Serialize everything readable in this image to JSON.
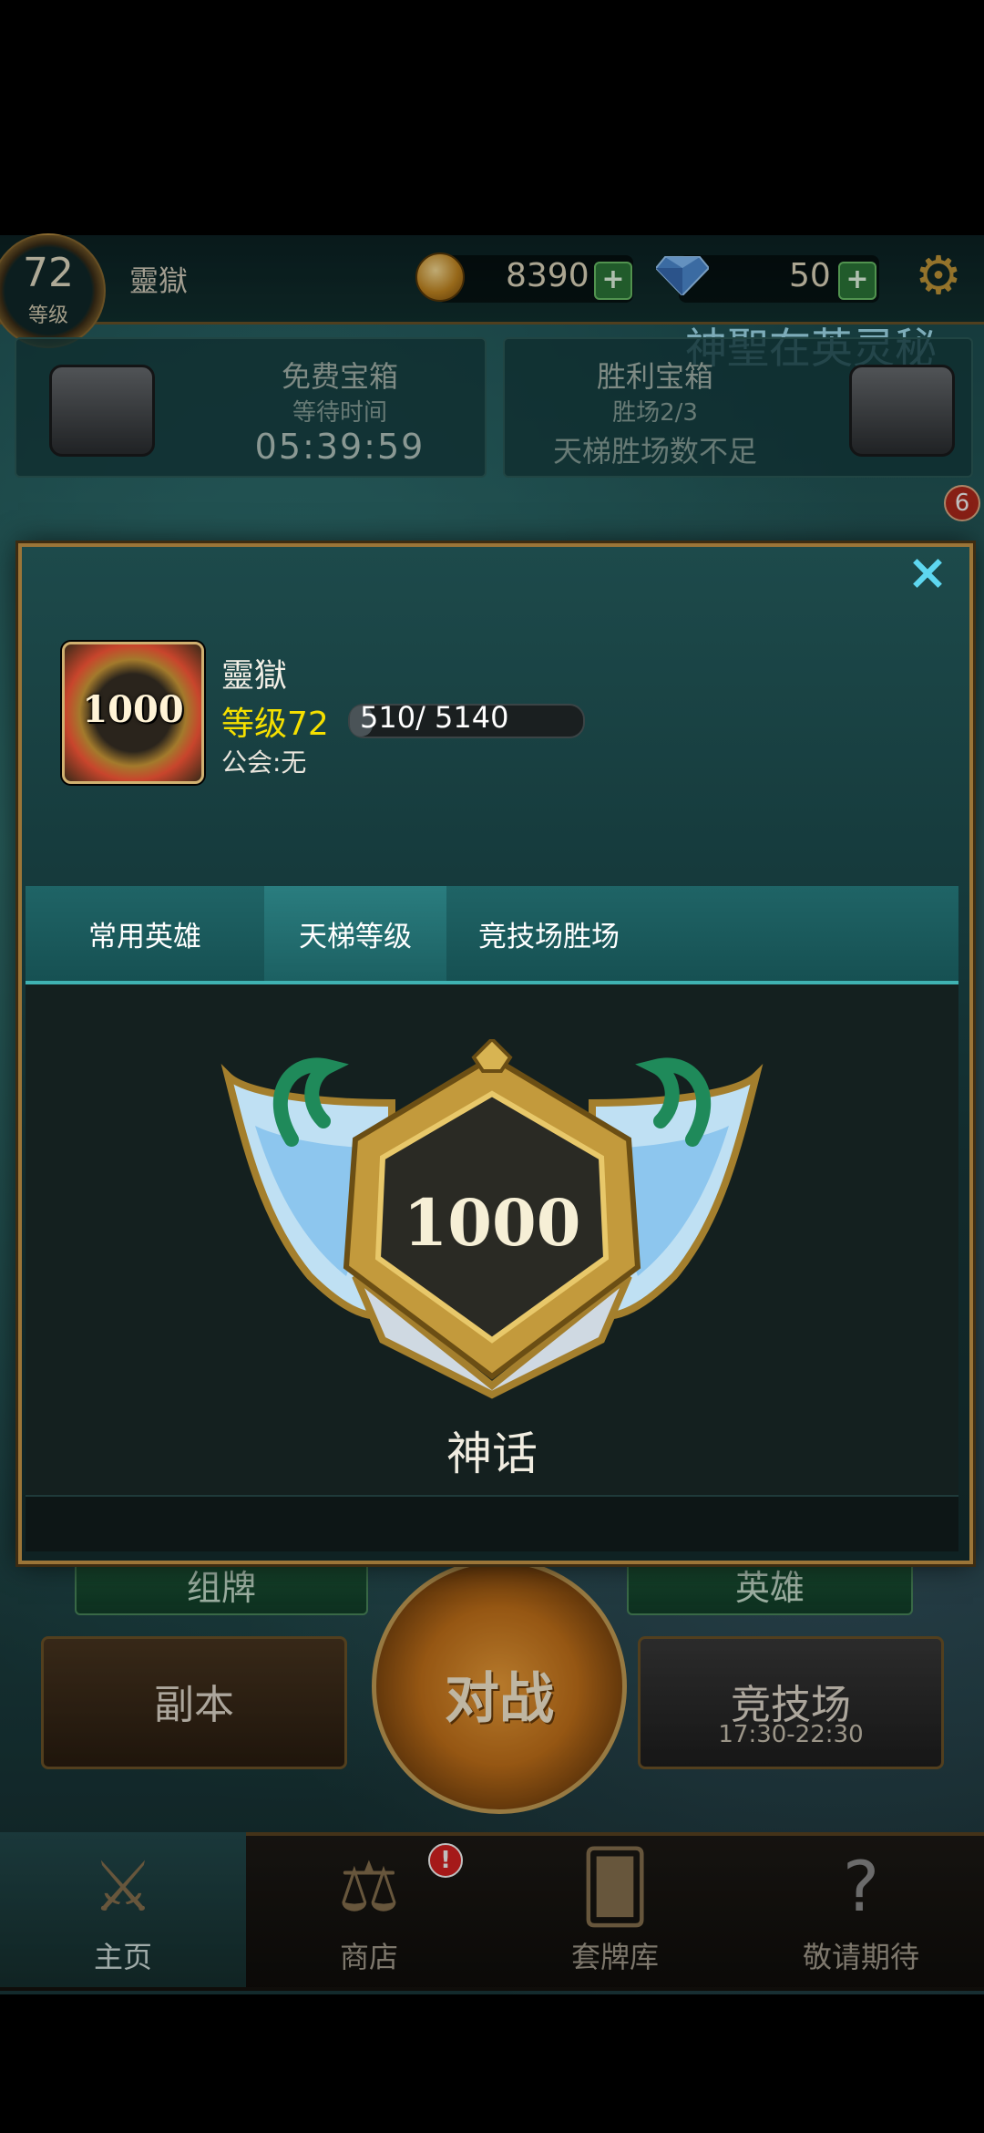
{
  "header": {
    "level": "72",
    "level_label": "等级",
    "player_name": "靈獄",
    "gold": "8390",
    "gems": "50",
    "plus": "+"
  },
  "banner_text": "神聖在英灵秘",
  "chests": {
    "free": {
      "title": "免费宝箱",
      "subtitle": "等待时间",
      "timer": "05:39:59"
    },
    "victory": {
      "title": "胜利宝箱",
      "subtitle": "胜场2/3",
      "status": "天梯胜场数不足"
    }
  },
  "notification_count": "6",
  "profile_modal": {
    "close_label": "×",
    "avatar_rank": "1000",
    "player_name": "靈獄",
    "level_text": "等级72",
    "xp_text": "510/ 5140",
    "xp_fraction": 0.099,
    "guild_text": "公会:无",
    "tabs": [
      {
        "label": "常用英雄"
      },
      {
        "label": "天梯等级"
      },
      {
        "label": "竞技场胜场"
      }
    ],
    "active_tab": "天梯等级",
    "rank_score": "1000",
    "rank_tier": "神话"
  },
  "menu": {
    "deck": "组牌",
    "heroes": "英雄",
    "battle": "对战",
    "dungeon": "副本",
    "arena": "竞技场",
    "arena_hours": "17:30-22:30"
  },
  "navbar": [
    {
      "label": "主页",
      "icon": "crossed-swords-icon"
    },
    {
      "label": "商店",
      "icon": "scales-icon",
      "badge": "!"
    },
    {
      "label": "套牌库",
      "icon": "cards-icon"
    },
    {
      "label": "敬请期待",
      "icon": "question-icon"
    }
  ],
  "colors": {
    "modal_border": "#9b7538",
    "close_icon": "#5ed7f0",
    "level_text": "#f5e000",
    "tab_accent": "#3fb2b2"
  }
}
